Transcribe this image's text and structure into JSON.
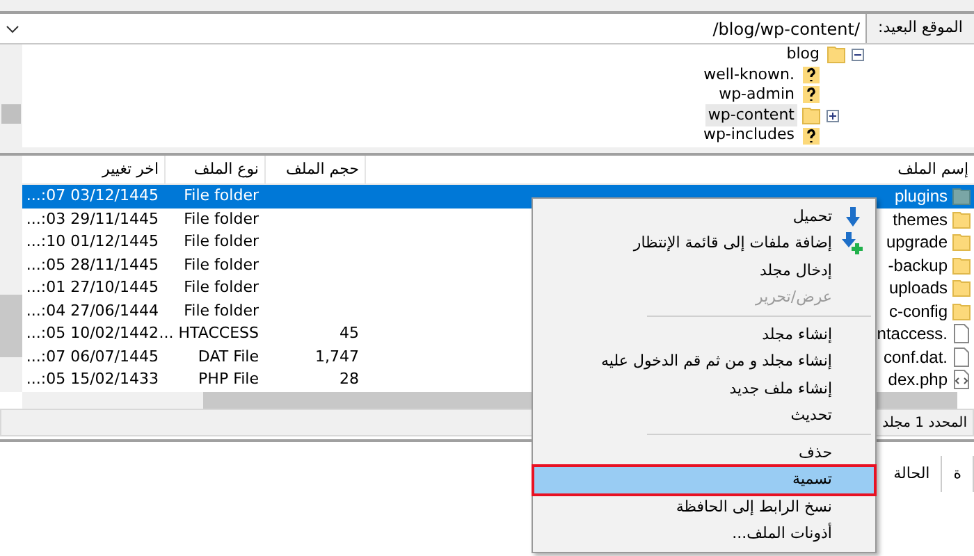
{
  "remote_site": {
    "label": "الموقع البعيد:",
    "path": "/blog/wp-content/"
  },
  "tree": [
    {
      "name": "blog",
      "kind": "folder",
      "expanded": true,
      "selected": false,
      "children": [
        {
          "name": "well-known.",
          "kind": "unknown",
          "selected": false
        },
        {
          "name": "wp-admin",
          "kind": "unknown",
          "selected": false
        },
        {
          "name": "wp-content",
          "kind": "folder",
          "expanded": false,
          "selected": true
        },
        {
          "name": "wp-includes",
          "kind": "unknown",
          "selected": false
        }
      ]
    }
  ],
  "file_list": {
    "columns": [
      "إسم الملف",
      "حجم الملف",
      "نوع الملف",
      "اخر تغيير"
    ],
    "rows": [
      {
        "name": "plugins",
        "kind": "folder",
        "size": "",
        "type": "File folder",
        "modified": "...:07 03/12/1445",
        "selected": true
      },
      {
        "name": "themes",
        "kind": "folder",
        "size": "",
        "type": "File folder",
        "modified": "...:03 29/11/1445",
        "selected": false
      },
      {
        "name": "upgrade",
        "kind": "folder",
        "size": "",
        "type": "File folder",
        "modified": "...:10 01/12/1445",
        "selected": false
      },
      {
        "name": "-backup",
        "kind": "folder",
        "size": "",
        "type": "File folder",
        "modified": "...:05 28/11/1445",
        "selected": false
      },
      {
        "name": "uploads",
        "kind": "folder",
        "size": "",
        "type": "File folder",
        "modified": "...:01 27/10/1445",
        "selected": false
      },
      {
        "name": "c-config",
        "kind": "folder",
        "size": "",
        "type": "File folder",
        "modified": "...:04 27/06/1444",
        "selected": false
      },
      {
        "name": "ntaccess.",
        "kind": "file",
        "size": "45",
        "type": "... HTACCESS",
        "modified": "...:05 10/02/1442",
        "selected": false
      },
      {
        "name": "conf.dat.",
        "kind": "file",
        "size": "1,747",
        "type": "DAT File",
        "modified": "...:07 06/07/1445",
        "selected": false
      },
      {
        "name": "dex.php",
        "kind": "code",
        "size": "28",
        "type": "PHP File",
        "modified": "...:05 15/02/1433",
        "selected": false
      }
    ]
  },
  "status_bar": "المحدد 1 مجلد",
  "tabs": [
    {
      "label": "ة",
      "selected": false
    },
    {
      "label": "الحالة",
      "selected": false
    }
  ],
  "context_menu": [
    {
      "kind": "download",
      "label": "تحميل",
      "disabled": false,
      "selected": false
    },
    {
      "kind": "queue",
      "label": "إضافة ملفات إلى قائمة الإنتظار",
      "disabled": false,
      "selected": false
    },
    {
      "kind": "item",
      "label": "إدخال مجلد",
      "disabled": false,
      "selected": false
    },
    {
      "kind": "item",
      "label": "عرض/تحرير",
      "disabled": true,
      "selected": false
    },
    {
      "kind": "separator"
    },
    {
      "kind": "item",
      "label": "إنشاء مجلد",
      "disabled": false,
      "selected": false
    },
    {
      "kind": "item",
      "label": "إنشاء مجلد و من ثم قم الدخول عليه",
      "disabled": false,
      "selected": false
    },
    {
      "kind": "item",
      "label": "إنشاء ملف جديد",
      "disabled": false,
      "selected": false
    },
    {
      "kind": "item",
      "label": "تحديث",
      "disabled": false,
      "selected": false
    },
    {
      "kind": "separator"
    },
    {
      "kind": "item",
      "label": "حذف",
      "disabled": false,
      "selected": false
    },
    {
      "kind": "item",
      "label": "تسمية",
      "disabled": false,
      "selected": true
    },
    {
      "kind": "item",
      "label": "نسخ الرابط إلى الحافظة",
      "disabled": false,
      "selected": false
    },
    {
      "kind": "item",
      "label": "أذونات الملف...",
      "disabled": false,
      "selected": false
    }
  ]
}
